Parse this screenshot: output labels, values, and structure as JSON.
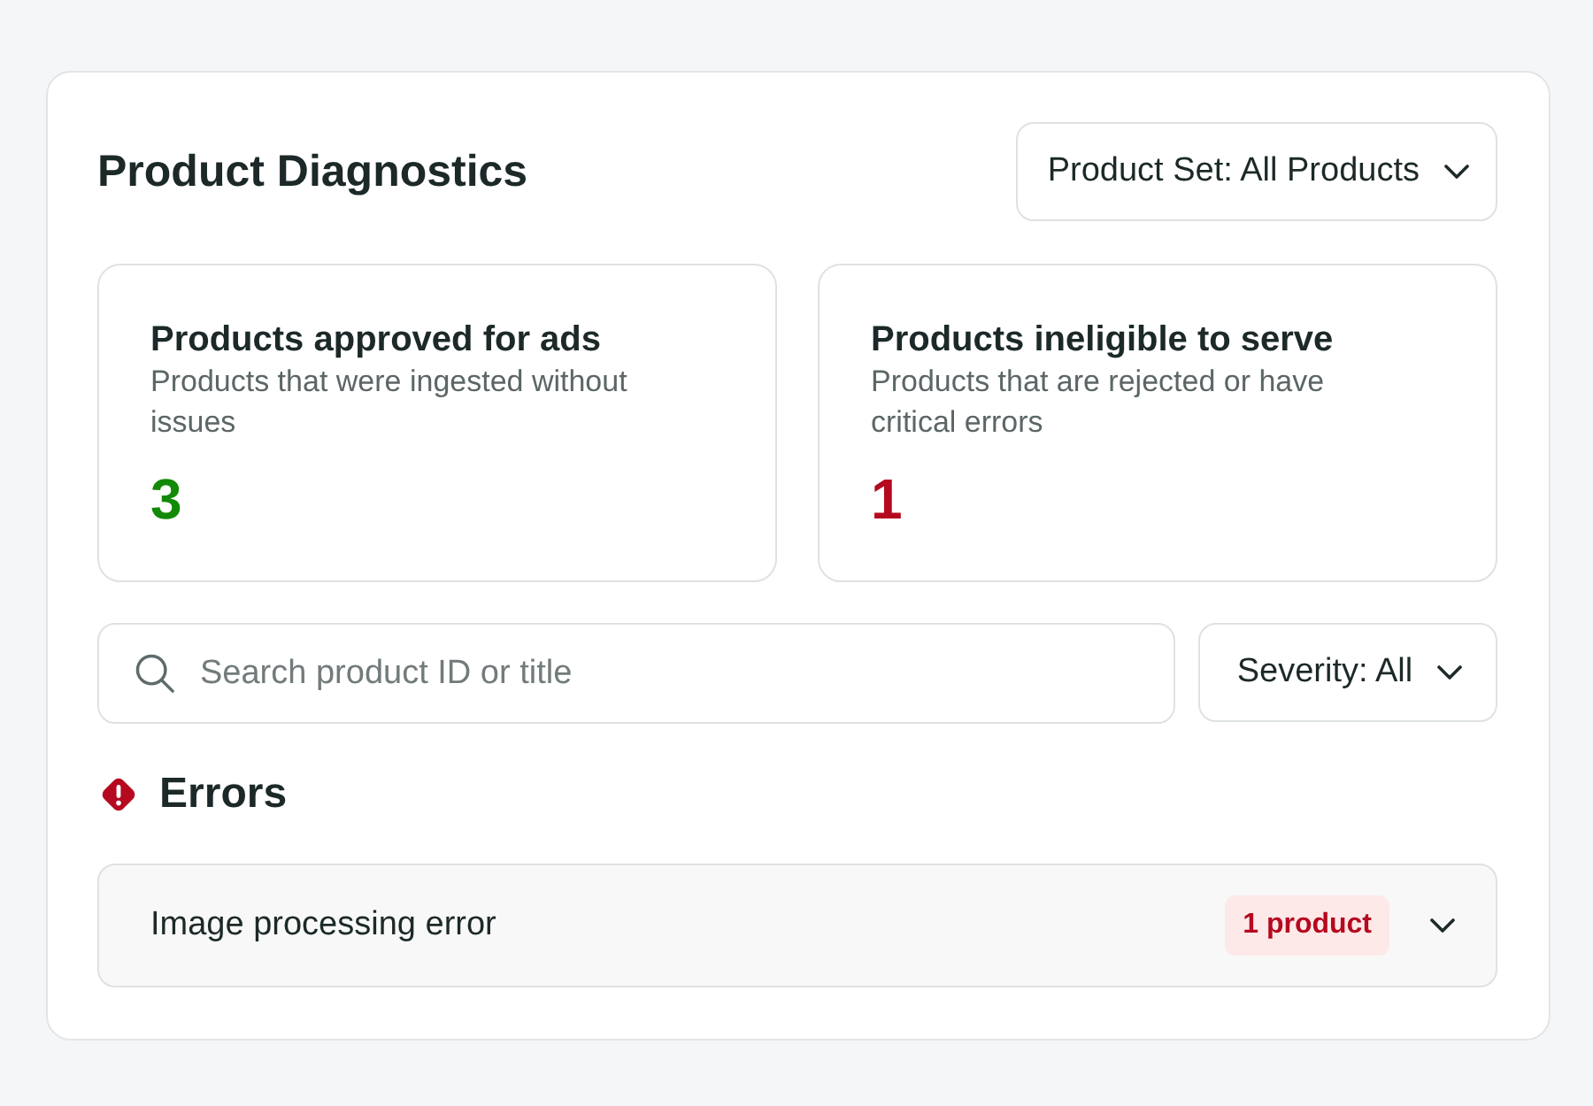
{
  "title": "Product Diagnostics",
  "product_set_dropdown": {
    "label": "Product Set: All Products"
  },
  "stats": [
    {
      "title": "Products approved for ads",
      "description": "Products that were ingested without issues",
      "value": "3",
      "color": "#138a07"
    },
    {
      "title": "Products ineligible to serve",
      "description": "Products that are rejected or have critical errors",
      "value": "1",
      "color": "#b5091f"
    }
  ],
  "search": {
    "placeholder": "Search product ID or title"
  },
  "severity_dropdown": {
    "label": "Severity: All"
  },
  "sections": [
    {
      "kind": "error",
      "heading": "Errors",
      "items": [
        {
          "label": "Image processing error",
          "count": "1 product",
          "expanded": false
        }
      ]
    }
  ]
}
